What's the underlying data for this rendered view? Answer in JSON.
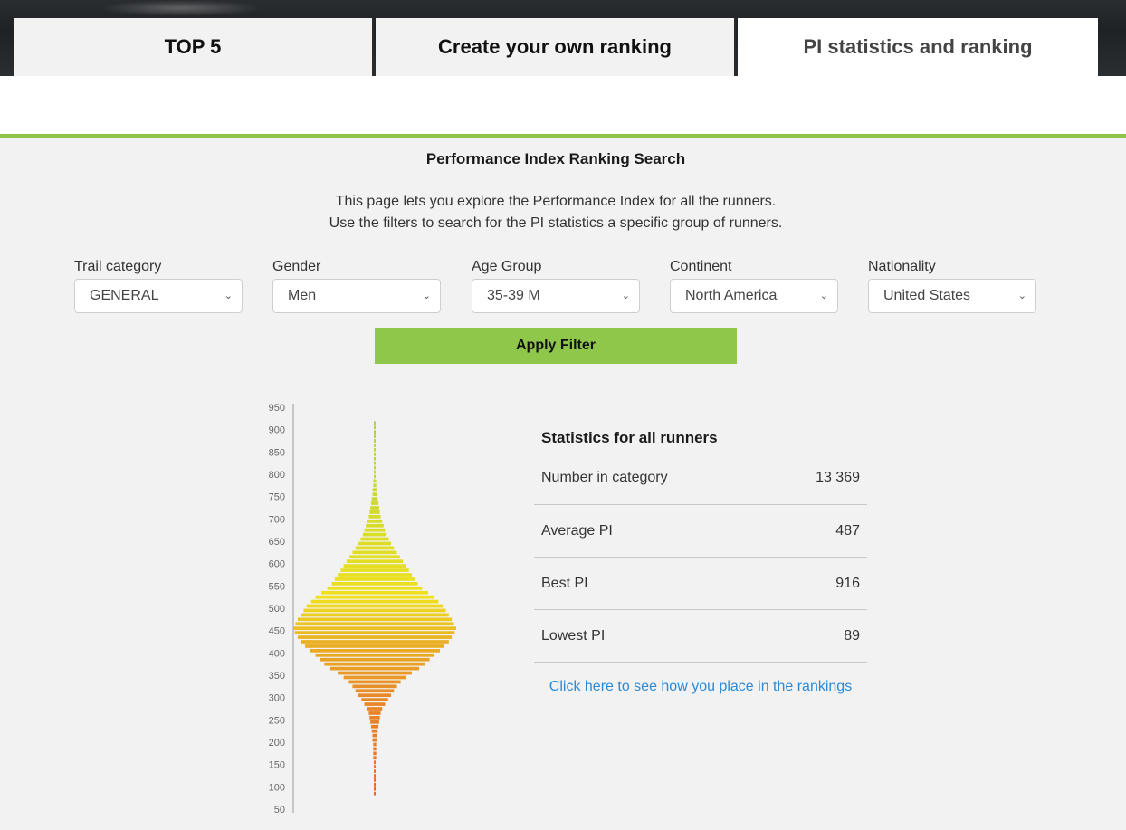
{
  "tabs": [
    {
      "label": "TOP 5"
    },
    {
      "label": "Create your own ranking"
    },
    {
      "label": "PI statistics and ranking"
    }
  ],
  "colors": {
    "accent_green": "#8fc24a",
    "button_green": "#8fc74a",
    "link_blue": "#2b8ad8"
  },
  "page": {
    "title": "Performance Index Ranking Search",
    "intro_line1": "This page lets you explore the Performance Index for all the runners.",
    "intro_line2": "Use the filters to search for the PI statistics a specific group of runners."
  },
  "filters": {
    "trail": {
      "label": "Trail category",
      "value": "GENERAL"
    },
    "gender": {
      "label": "Gender",
      "value": "Men"
    },
    "age": {
      "label": "Age Group",
      "value": "35-39 M"
    },
    "continent": {
      "label": "Continent",
      "value": "North America"
    },
    "nationality": {
      "label": "Nationality",
      "value": "United States"
    },
    "apply_label": "Apply Filter"
  },
  "stats": {
    "title": "Statistics for all runners",
    "number_label": "Number in category",
    "number_value": "13 369",
    "average_label": "Average PI",
    "average_value": "487",
    "best_label": "Best PI",
    "best_value": "916",
    "lowest_label": "Lowest PI",
    "lowest_value": "89",
    "link_text": "Click here to see how you place in the rankings"
  },
  "chart_data": {
    "type": "bar",
    "orientation": "horizontal-centered",
    "y_ticks": [
      950,
      900,
      850,
      800,
      750,
      700,
      650,
      600,
      550,
      500,
      450,
      400,
      350,
      300,
      250,
      200,
      150,
      100,
      50
    ],
    "ylim": [
      50,
      950
    ],
    "bin_width": 10,
    "bins": [
      80,
      90,
      100,
      110,
      120,
      130,
      140,
      150,
      160,
      170,
      180,
      190,
      200,
      210,
      220,
      230,
      240,
      250,
      260,
      270,
      280,
      290,
      300,
      310,
      320,
      330,
      340,
      350,
      360,
      370,
      380,
      390,
      400,
      410,
      420,
      430,
      440,
      450,
      460,
      470,
      480,
      490,
      500,
      510,
      520,
      530,
      540,
      550,
      560,
      570,
      580,
      590,
      600,
      610,
      620,
      630,
      640,
      650,
      660,
      670,
      680,
      690,
      700,
      710,
      720,
      730,
      740,
      750,
      760,
      770,
      780,
      790,
      800,
      810,
      820,
      830,
      840,
      850,
      860,
      870,
      880,
      890,
      900,
      910
    ],
    "values": [
      1,
      1,
      1,
      1,
      1,
      1,
      1,
      1,
      2,
      2,
      2,
      2,
      3,
      3,
      4,
      5,
      6,
      7,
      8,
      10,
      14,
      18,
      22,
      26,
      30,
      35,
      42,
      50,
      60,
      68,
      74,
      80,
      88,
      94,
      100,
      104,
      108,
      110,
      107,
      104,
      100,
      96,
      92,
      86,
      80,
      72,
      64,
      58,
      54,
      50,
      46,
      42,
      38,
      34,
      30,
      26,
      22,
      19,
      16,
      14,
      12,
      10,
      8,
      7,
      6,
      5,
      4,
      3,
      3,
      2,
      2,
      1,
      1,
      1,
      1,
      1,
      1,
      1,
      1,
      1,
      1,
      1,
      1,
      1
    ],
    "grid": false,
    "legend": "none"
  }
}
